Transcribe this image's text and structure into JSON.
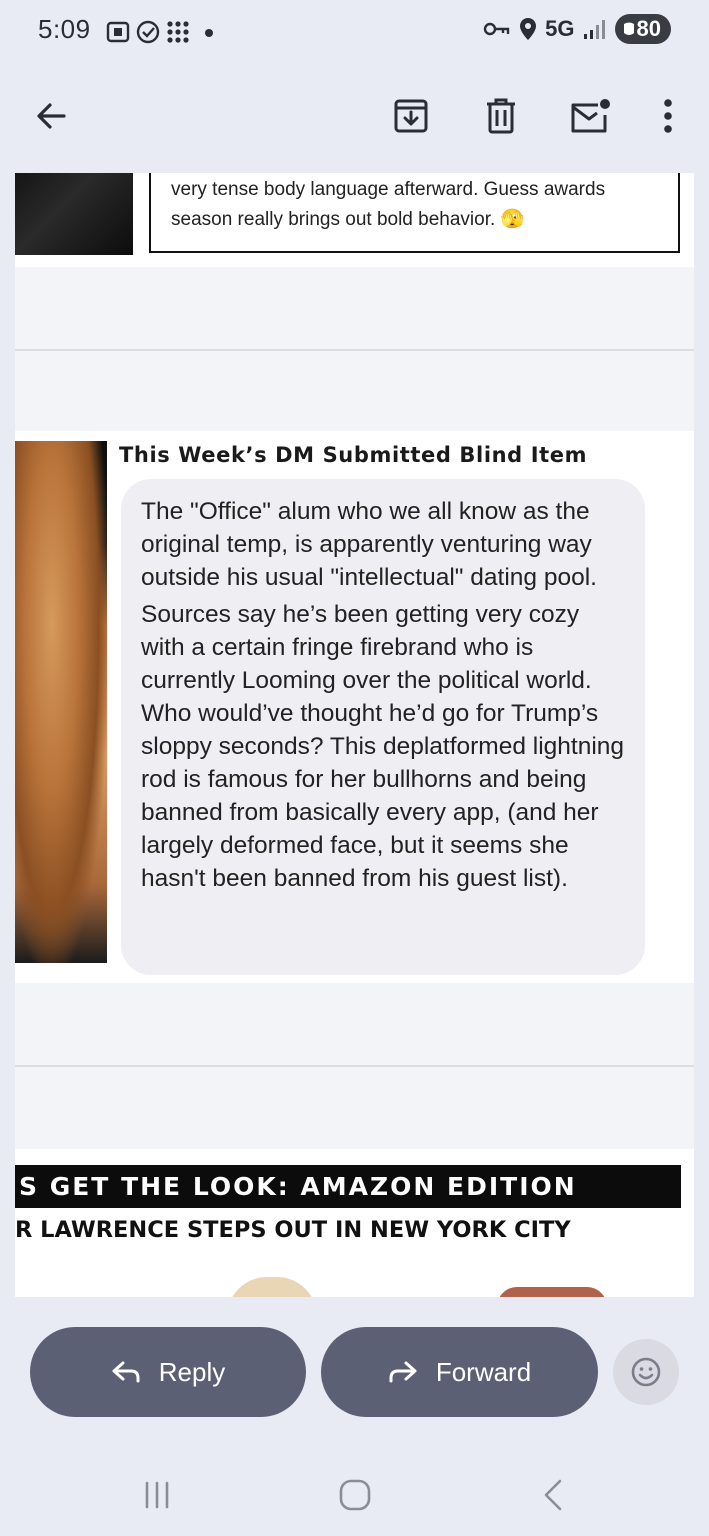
{
  "status_bar": {
    "time": "5:09",
    "network": "5G",
    "battery": "80"
  },
  "toolbar": {
    "back_icon": "arrow-left-icon",
    "archive_icon": "archive-icon",
    "delete_icon": "trash-icon",
    "unread_icon": "mark-unread-icon",
    "more_icon": "more-vert-icon"
  },
  "email": {
    "quote_text": "very tense body language afterward. Guess awards season really brings out bold behavior. 🫣",
    "blind_item_title": "This Week’s DM Submitted Blind Item",
    "blind_item_paragraphs": [
      "The \"Office\" alum who we all know as the original temp, is apparently venturing way outside his usual \"intellectual\" dating pool.",
      "Sources say he’s been getting very cozy with a certain fringe firebrand who is currently Looming over the political world. Who would’ve thought he’d go for Trump’s sloppy seconds? This deplatformed lightning rod is famous for her bullhorns and being banned from basically every app, (and her largely deformed face, but it seems she hasn't been banned from his guest list)."
    ],
    "section_banner": "S GET THE LOOK: AMAZON EDITION",
    "section_subhead": "R LAWRENCE STEPS OUT IN NEW YORK CITY"
  },
  "actions": {
    "reply_label": "Reply",
    "forward_label": "Forward"
  },
  "colors": {
    "pill_bg": "#5b6074",
    "page_bg": "#e9ebf4"
  }
}
